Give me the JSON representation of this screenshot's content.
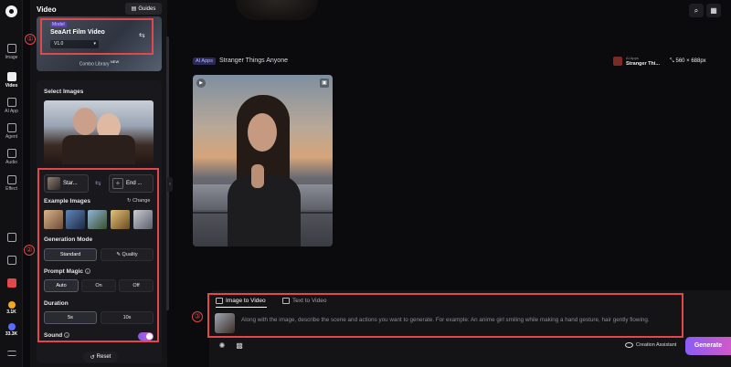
{
  "rail": {
    "items": [
      {
        "label": "Image",
        "icon": "image-icon"
      },
      {
        "label": "Video",
        "icon": "video-icon"
      },
      {
        "label": "AI App",
        "icon": "ai-app-icon"
      },
      {
        "label": "Agent",
        "icon": "agent-icon"
      },
      {
        "label": "Audio",
        "icon": "audio-icon"
      },
      {
        "label": "Effect",
        "icon": "effect-icon"
      }
    ],
    "stats": [
      {
        "value": "3.1K",
        "color": "#f5a623"
      },
      {
        "value": "33.3K",
        "color": "#5a6cff"
      }
    ]
  },
  "panel": {
    "title": "Video",
    "guides_label": "Guides",
    "model": {
      "tag": "Model",
      "name": "SeaArt Film Video",
      "version": "V1.0",
      "combo_label": "Combo Library",
      "combo_badge": "NEW"
    },
    "select_images_label": "Select Images",
    "frames": {
      "start": "Star...",
      "end": "End ..."
    },
    "example_images_label": "Example Images",
    "change_label": "Change",
    "generation_mode": {
      "label": "Generation Mode",
      "options": [
        "Standard",
        "Quality"
      ],
      "selected": "Standard"
    },
    "prompt_magic": {
      "label": "Prompt Magic",
      "options": [
        "Auto",
        "On",
        "Off"
      ],
      "selected": "Auto"
    },
    "duration": {
      "label": "Duration",
      "options": [
        "5s",
        "10s"
      ],
      "selected": "5s"
    },
    "sound": {
      "label": "Sound",
      "enabled": true
    },
    "reset_label": "Reset"
  },
  "annotations": {
    "one": "①",
    "two": "②",
    "three": "③"
  },
  "main": {
    "app_tag": "AI Apps",
    "app_title": "Stranger Things Anyone",
    "mini": {
      "tag": "AI Apps",
      "name": "Stranger Thi..."
    },
    "dimensions": "560 × 688px"
  },
  "composer": {
    "tabs": [
      "Image to Video",
      "Text to Video"
    ],
    "active_tab": "Image to Video",
    "prompt_placeholder": "Along with the image, describe the scene and actions you want to generate. For example: An anime girl smiling while making a hand gesture, hair gently flowing.",
    "assistant_label": "Creation Assistant",
    "generate_label": "Generate"
  },
  "colors": {
    "highlight": "#e0484a",
    "accent_start": "#8a5cf6",
    "accent_end": "#cf5ac6"
  }
}
